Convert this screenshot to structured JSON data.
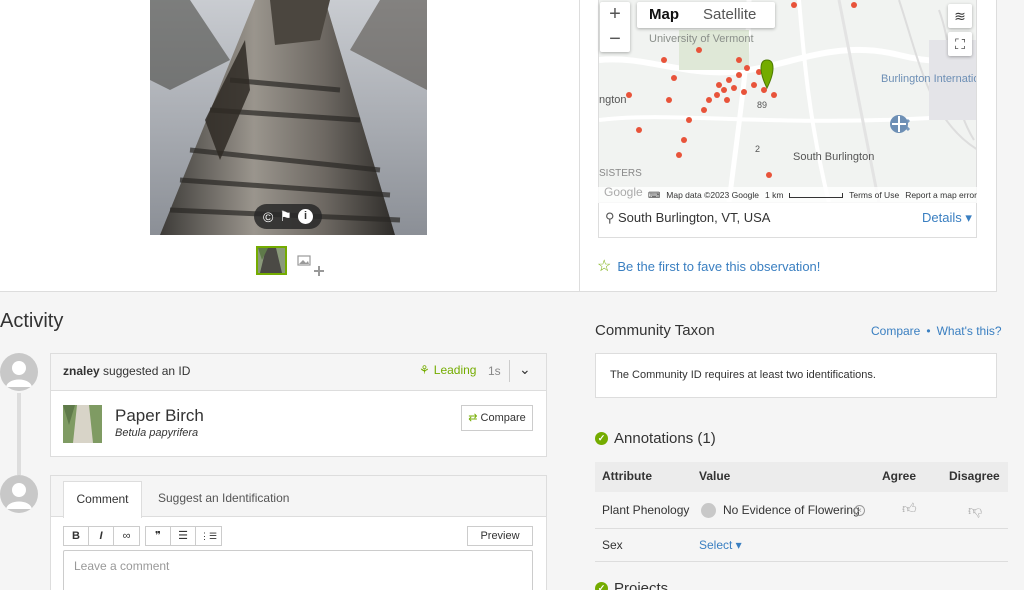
{
  "photo": {
    "controls": [
      "©",
      "flag",
      "i"
    ]
  },
  "map": {
    "zoom_in": "+",
    "zoom_out": "−",
    "type_map": "Map",
    "type_satellite": "Satellite",
    "labels": [
      "University of Vermont",
      "Burlington International Airport",
      "South Burlington",
      "ngton",
      "SISTERS",
      "2",
      "89"
    ],
    "attribution": "Map data ©2023 Google",
    "scale": "1 km",
    "terms": "Terms of Use",
    "report": "Report a map error",
    "google": "Google"
  },
  "location": {
    "place": "South Burlington, VT, USA",
    "details_label": "Details ▾"
  },
  "fave": {
    "label": "Be the first to fave this observation!"
  },
  "activity": {
    "title": "Activity",
    "identification": {
      "user": "znaley",
      "action": " suggested an ID",
      "leading_label": "Leading",
      "time": "1s",
      "common_name": "Paper Birch",
      "scientific_name": "Betula papyrifera",
      "compare_label": "Compare"
    },
    "comment_form": {
      "tab_comment": "Comment",
      "tab_suggest": "Suggest an Identification",
      "format_buttons": [
        "B",
        "I",
        "∞",
        "❞",
        "☰",
        "⋮☰"
      ],
      "preview_label": "Preview",
      "placeholder": "Leave a comment"
    }
  },
  "community_taxon": {
    "title": "Community Taxon",
    "compare_link": "Compare",
    "dot": "•",
    "whats_this_link": "What's this?",
    "message": "The Community ID requires at least two identifications."
  },
  "annotations": {
    "title": "Annotations (1)",
    "headers": {
      "attribute": "Attribute",
      "value": "Value",
      "agree": "Agree",
      "disagree": "Disagree"
    },
    "rows": [
      {
        "attribute": "Plant Phenology",
        "value": "No Evidence of Flowering"
      },
      {
        "attribute": "Sex",
        "value": "Select ▾"
      }
    ]
  },
  "projects": {
    "title": "Projects"
  },
  "colors": {
    "accent_green": "#74ac00",
    "link_blue": "#3a7fc1",
    "map_pin": "#e8533a"
  }
}
